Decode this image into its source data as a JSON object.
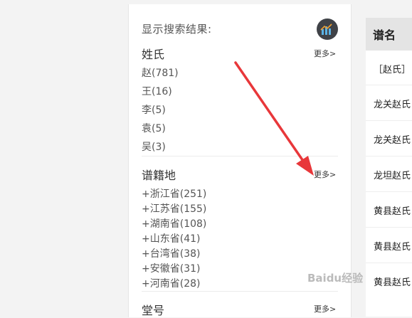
{
  "panel": {
    "title": "显示搜索结果:",
    "chart_icon": "bar-chart-icon"
  },
  "surname": {
    "title": "姓氏",
    "more": "更多>",
    "items": [
      "赵(781)",
      "王(16)",
      "李(5)",
      "袁(5)",
      "吴(3)"
    ]
  },
  "origin": {
    "title": "谱籍地",
    "more": "更多>",
    "items": [
      "+浙江省(251)",
      "+江苏省(155)",
      "+湖南省(108)",
      "+山东省(41)",
      "+台湾省(38)",
      "+安徽省(31)",
      "+河南省(28)"
    ]
  },
  "next_section": {
    "title": "堂号",
    "more": "更多>"
  },
  "table": {
    "header": "谱名",
    "rows": [
      "［赵氏］",
      "龙关赵氏",
      "龙关赵氏",
      "龙坦赵氏",
      "黄县赵氏",
      "黄县赵氏",
      "黄县赵氏"
    ]
  },
  "watermark": "Baidu经验",
  "colors": {
    "arrow": "#e8373a",
    "header_bg": "#e4e4e4",
    "icon_bg": "#3f4247"
  }
}
